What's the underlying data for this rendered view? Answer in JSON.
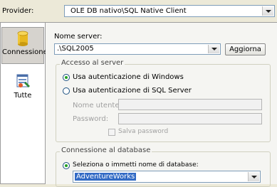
{
  "provider": {
    "label": "Provider:",
    "value": "OLE DB nativo\\SQL Native Client"
  },
  "nav": {
    "items": [
      {
        "label": "Connessione",
        "icon": "database-cylinder-icon",
        "selected": true
      },
      {
        "label": "Tutte",
        "icon": "property-sheet-icon",
        "selected": false
      }
    ]
  },
  "server": {
    "label": "Nome server:",
    "value": ".\\SQL2005",
    "refresh_label": "Aggiorna"
  },
  "auth": {
    "group_title": "Accesso al server",
    "windows_label": "Usa autenticazione di Windows",
    "sql_label": "Usa autenticazione di SQL Server",
    "selected": "windows",
    "username_label": "Nome utente:",
    "username_value": "",
    "password_label": "Password:",
    "password_value": "",
    "save_password_label": "Salva password"
  },
  "database": {
    "group_title": "Connessione al database",
    "select_label": "Seleziona o immetti nome di database:",
    "value": "AdventureWorks"
  }
}
